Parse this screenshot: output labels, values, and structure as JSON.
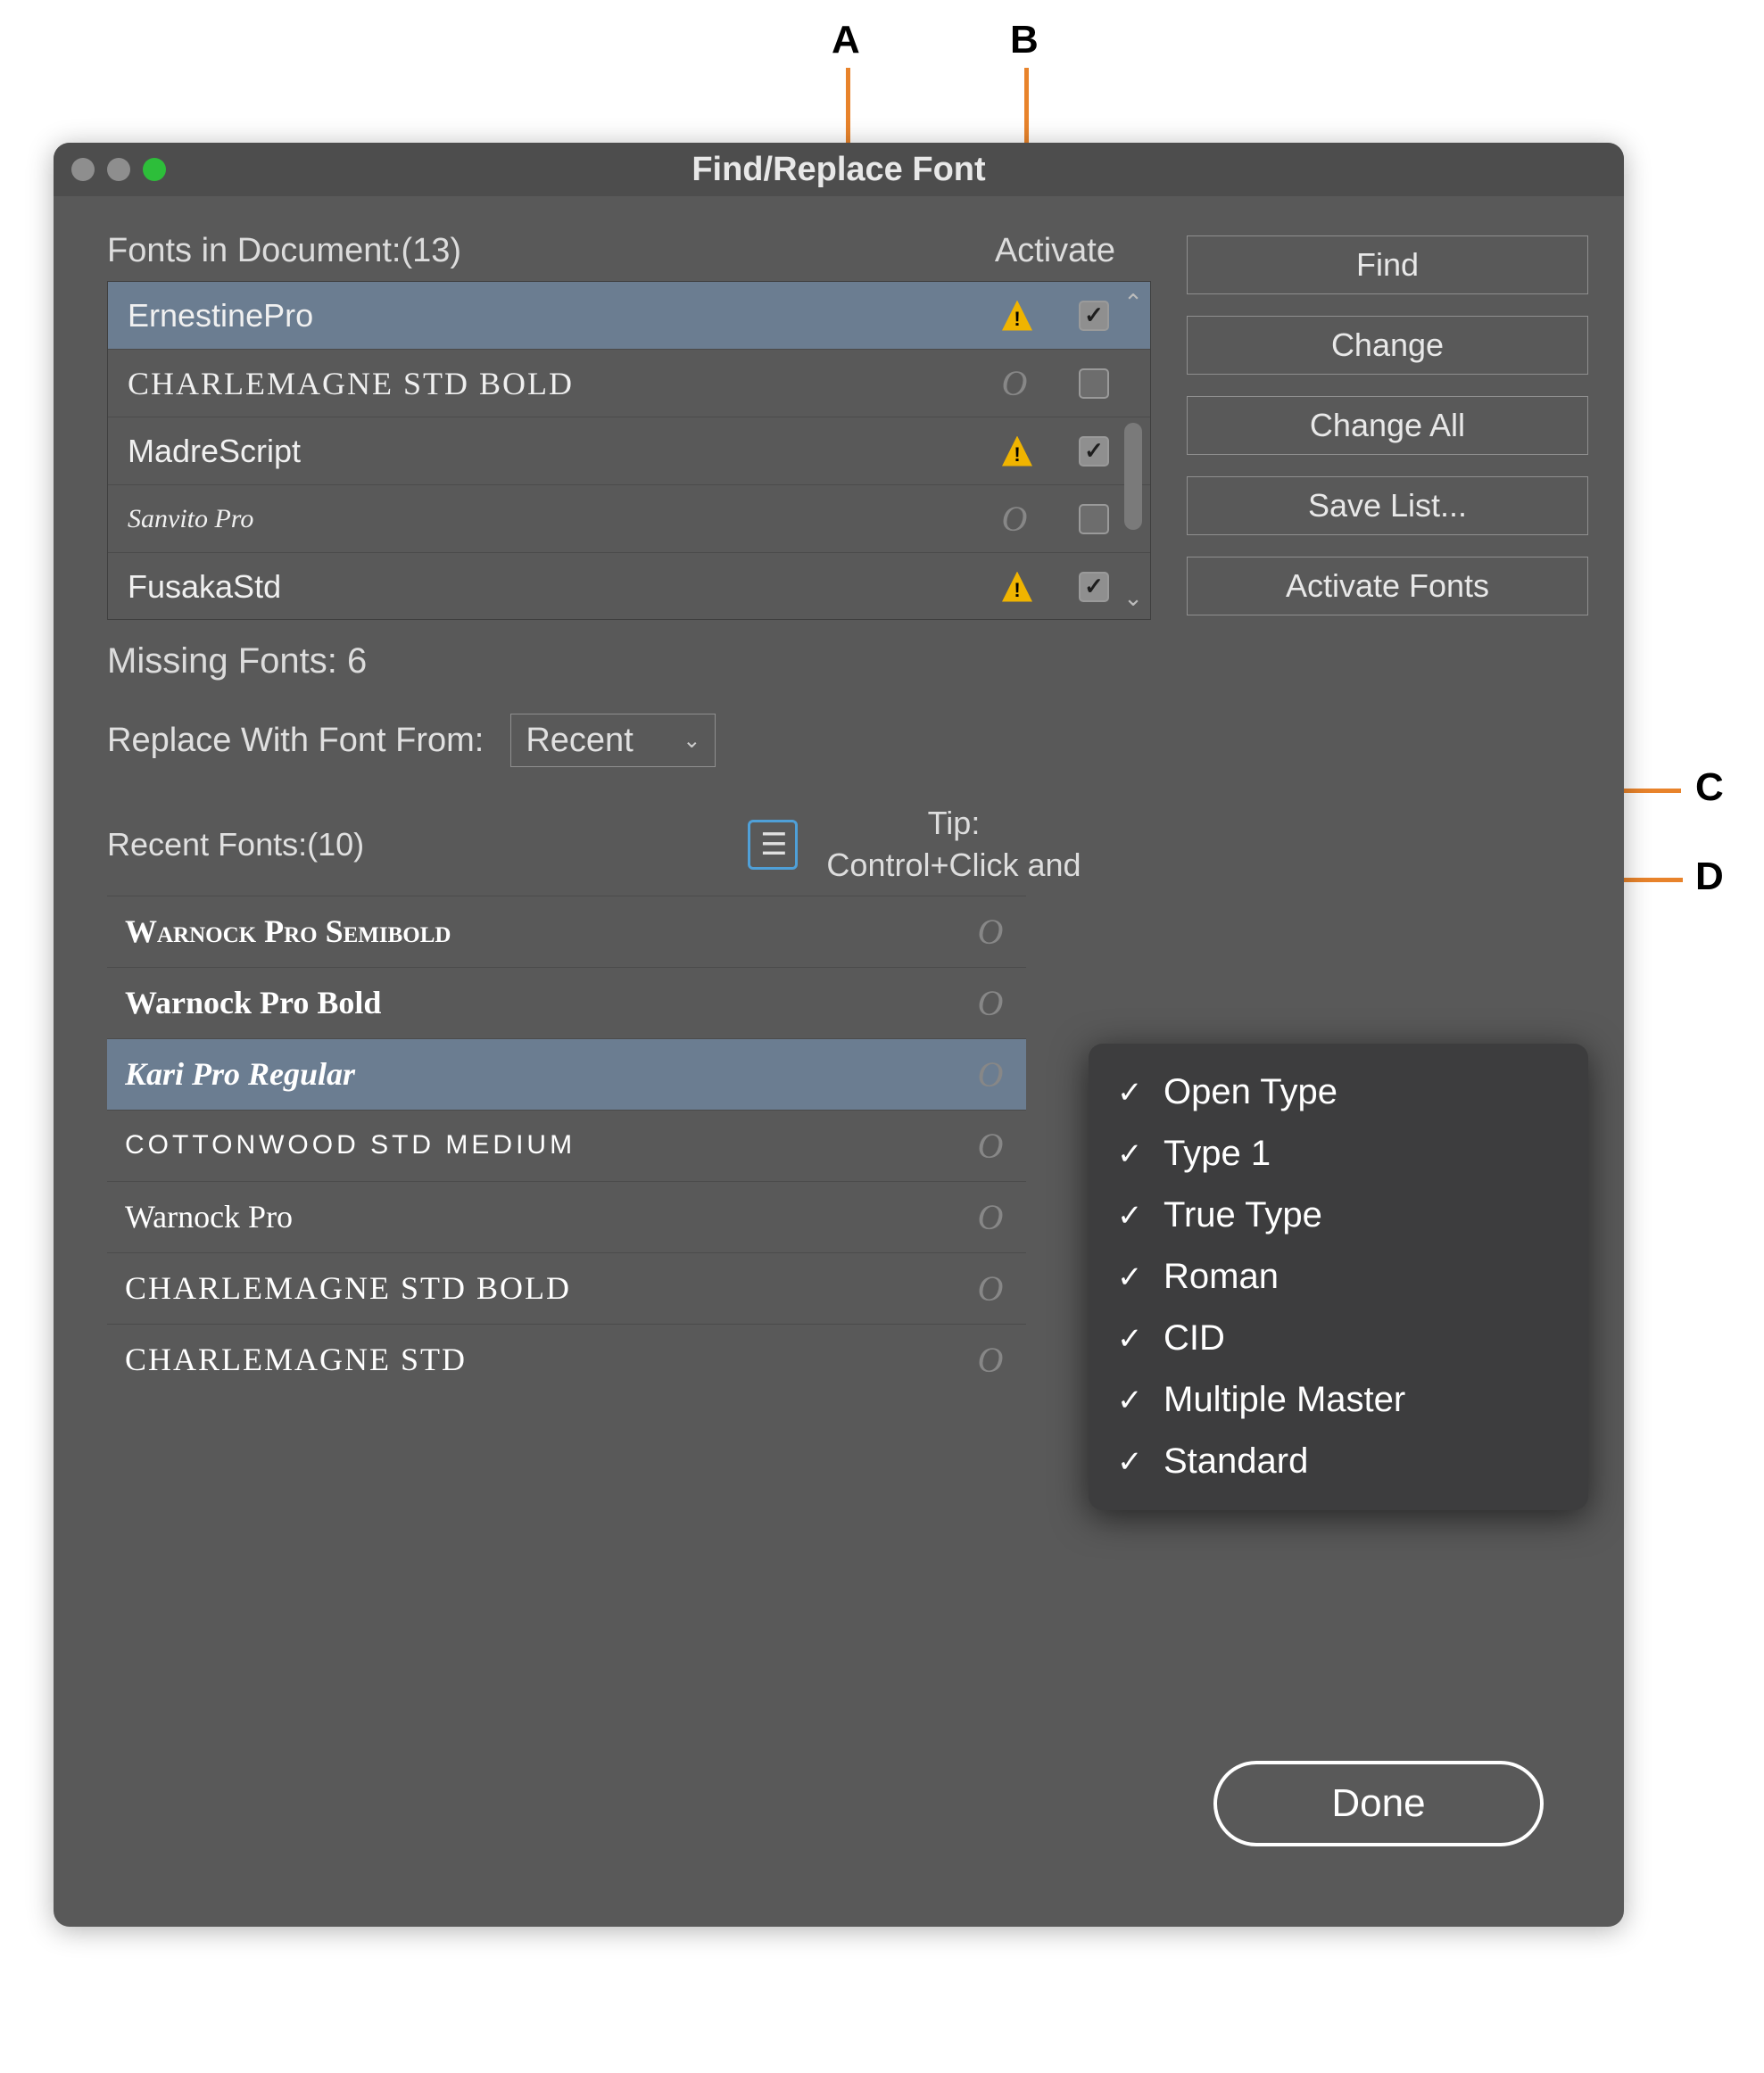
{
  "window": {
    "title": "Find/Replace Font"
  },
  "fonts_header": {
    "label": "Fonts in Document:(13)",
    "activate_label": "Activate"
  },
  "doc_fonts": [
    {
      "name": "ErnestinePro",
      "warn": true,
      "checked": true,
      "selected": true
    },
    {
      "name": "CHARLEMAGNE STD BOLD",
      "warn": false,
      "checked": false,
      "selected": false,
      "cls": "f-charlemagne"
    },
    {
      "name": "MadreScript",
      "warn": true,
      "checked": true,
      "selected": false
    },
    {
      "name": "Sanvito Pro",
      "warn": false,
      "checked": false,
      "selected": false,
      "cls": "f-sanvito"
    },
    {
      "name": "FusakaStd",
      "warn": true,
      "checked": true,
      "selected": false
    }
  ],
  "missing": "Missing Fonts: 6",
  "replace_label": "Replace With Font From:",
  "replace_value": "Recent",
  "recent_label": "Recent Fonts:(10)",
  "tip": {
    "title": "Tip:",
    "text": "Control+Click and"
  },
  "recent_fonts": [
    {
      "name": "Warnock Pro Semibold",
      "cls": "f-warnock-sb",
      "selected": false
    },
    {
      "name": "Warnock Pro Bold",
      "cls": "f-warnock-b",
      "selected": false
    },
    {
      "name": "Kari Pro Regular",
      "cls": "f-kari",
      "selected": true
    },
    {
      "name": "COTTONWOOD STD MEDIUM",
      "cls": "f-cotton",
      "selected": false
    },
    {
      "name": "Warnock Pro",
      "cls": "f-warnock",
      "selected": false
    },
    {
      "name": "CHARLEMAGNE STD BOLD",
      "cls": "f-charlemagne",
      "selected": false
    },
    {
      "name": "CHARLEMAGNE STD",
      "cls": "f-charlemagne",
      "selected": false
    }
  ],
  "buttons": {
    "find": "Find",
    "change": "Change",
    "change_all": "Change All",
    "save_list": "Save List...",
    "activate_fonts": "Activate Fonts",
    "done": "Done"
  },
  "menu_items": [
    "Open Type",
    "Type 1",
    "True Type",
    "Roman",
    "CID",
    "Multiple Master",
    "Standard"
  ],
  "callouts": {
    "A": "A",
    "B": "B",
    "C": "C",
    "D": "D"
  },
  "o_glyph": "O"
}
